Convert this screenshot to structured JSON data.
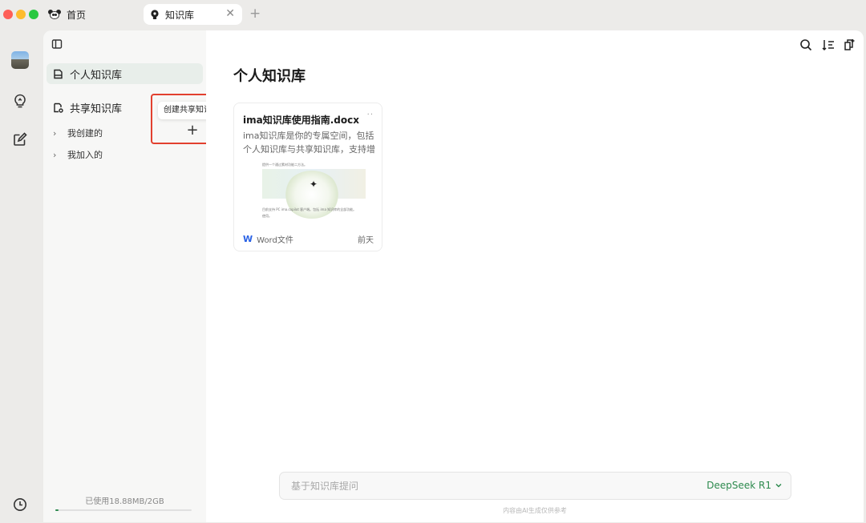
{
  "tabs": {
    "home": {
      "label": "首页"
    },
    "knowledge": {
      "label": "知识库",
      "close": "✕"
    },
    "new_tab": "+"
  },
  "sidebar": {
    "personal": {
      "label": "个人知识库"
    },
    "shared": {
      "label": "共享知识库"
    },
    "tree": [
      {
        "chevron": "›",
        "label": "我创建的"
      },
      {
        "chevron": "›",
        "label": "我加入的"
      }
    ],
    "add_button": "+",
    "tooltip": "创建共享知识库",
    "usage": {
      "text": "已使用18.88MB/2GB",
      "fraction": 0.0092
    }
  },
  "main": {
    "title": "个人知识库",
    "card": {
      "title": "ima知识库使用指南.docx",
      "more": "··",
      "description": "ima知识库是你的专属空间，包括个人知识库与共享知识库，支持增添…",
      "preview_line_1": "提供一个通过素材功能二方法。",
      "preview_line_2": "目前支持 PC ima.copilot 客户端。包括 ima 知识库的全部功能。",
      "preview_line_3": "使用。",
      "preview_spark": "✦",
      "type_icon": "W",
      "type_label": "Word文件",
      "date": "前天"
    },
    "ask": {
      "placeholder": "基于知识库提问",
      "value": ""
    },
    "model": {
      "label": "DeepSeek R1",
      "chevron": "⌄"
    },
    "disclaimer": "内容由AI生成仅供参考"
  },
  "colors": {
    "accent_green": "#2d8a4e",
    "highlight_red": "#e2402f",
    "word_blue": "#2a62e5"
  },
  "icons": [
    "panda-logo-icon",
    "bulb-icon",
    "close-icon",
    "clock-icon",
    "edit-note-icon",
    "sidebar-toggle-icon",
    "kb-icon",
    "shared-kb-icon",
    "search-icon",
    "sort-icon",
    "new-doc-icon"
  ]
}
